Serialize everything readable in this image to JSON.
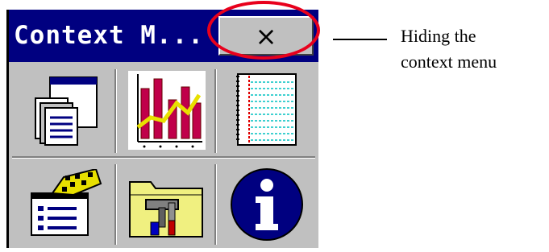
{
  "window": {
    "title": "Context M..."
  },
  "close_button": {
    "label": "×",
    "icon": "close-icon"
  },
  "grid_items": [
    {
      "icon": "windows-icon"
    },
    {
      "icon": "chart-icon"
    },
    {
      "icon": "notebook-icon"
    },
    {
      "icon": "form-edit-icon"
    },
    {
      "icon": "tools-folder-icon"
    },
    {
      "icon": "info-icon"
    }
  ],
  "annotation": {
    "line1": "Hiding the",
    "line2": "context menu"
  },
  "colors": {
    "titlebar": "#000080",
    "highlight": "#e8001c",
    "menu_bg": "#c0c0c0"
  }
}
